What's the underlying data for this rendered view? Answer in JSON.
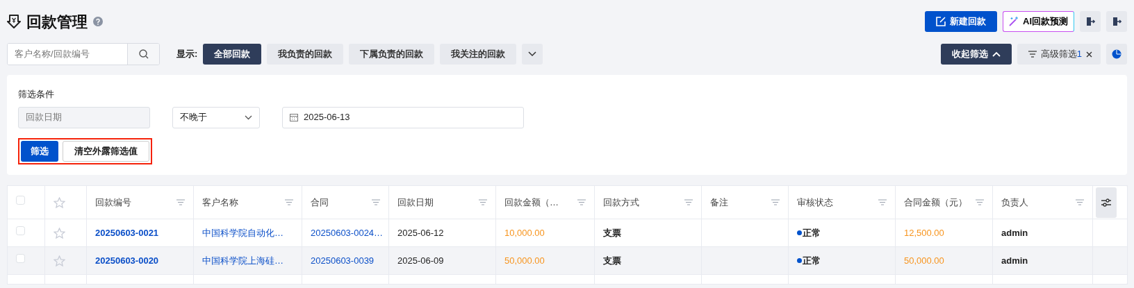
{
  "page": {
    "title": "回款管理"
  },
  "header_actions": [
    {
      "kind": "primary",
      "label": "新建回款"
    },
    {
      "kind": "ai",
      "label": "AI回款预测"
    },
    {
      "kind": "icon"
    },
    {
      "kind": "icon"
    }
  ],
  "search": {
    "placeholder": "客户名称/回款编号"
  },
  "view_filter": {
    "label": "显示:",
    "options": [
      {
        "label": "全部回款",
        "selected": true
      },
      {
        "label": "我负责的回款",
        "selected": false
      },
      {
        "label": "下属负责的回款",
        "selected": false
      },
      {
        "label": "我关注的回款",
        "selected": false
      }
    ]
  },
  "filter_toggle": {
    "label": "收起筛选",
    "expanded": true
  },
  "advanced_filter": {
    "label": "高级筛选",
    "count": "1"
  },
  "filter_panel": {
    "title": "筛选条件",
    "field": {
      "value": "回款日期",
      "disabled": true
    },
    "operator": {
      "value": "不晚于"
    },
    "date": {
      "value": "2025-06-13"
    },
    "buttons": [
      {
        "kind": "primary",
        "label": "筛选"
      },
      {
        "kind": "default",
        "label": "清空外露筛选值"
      }
    ],
    "highlighted": true
  },
  "table": {
    "all_checked": false,
    "columns": [
      "回款编号",
      "客户名称",
      "合同",
      "回款日期",
      "回款金额（…",
      "回款方式",
      "备注",
      "审核状态",
      "合同金额（元）",
      "负责人"
    ],
    "rows": [
      {
        "checked": false,
        "starred": false,
        "hovered": false,
        "cells": [
          "20250603-0021",
          "中国科学院自动化…",
          "20250603-0024…",
          "2025-06-12",
          "10,000.00",
          "支票",
          "",
          "正常",
          "12,500.00",
          "admin"
        ],
        "color": "#0052cc"
      },
      {
        "checked": false,
        "starred": false,
        "hovered": true,
        "cells": [
          "20250603-0020",
          "中国科学院上海硅…",
          "20250603-0039",
          "2025-06-09",
          "50,000.00",
          "支票",
          "",
          "正常",
          "50,000.00",
          "admin"
        ],
        "color": "#0052cc"
      }
    ]
  }
}
